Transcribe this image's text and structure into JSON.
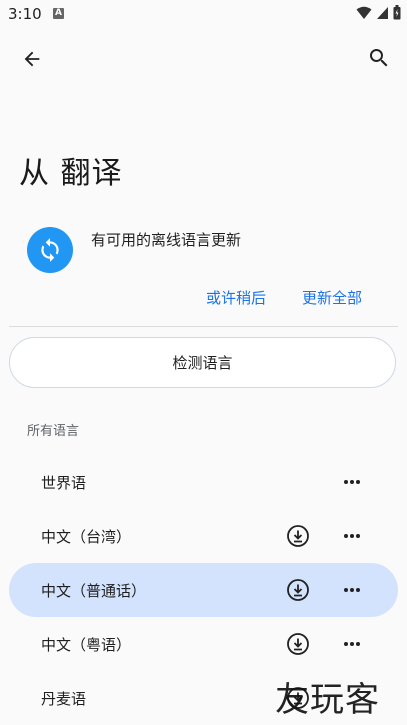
{
  "status_bar": {
    "time": "3:10",
    "notification_letter": "A"
  },
  "top_bar": {
    "back_icon": "arrow-back-icon",
    "search_icon": "search-icon"
  },
  "page_title": "从 翻译",
  "update_banner": {
    "icon": "sync-icon",
    "accent_color": "#2196f3",
    "message": "有可用的离线语言更新",
    "later_label": "或许稍后",
    "update_all_label": "更新全部"
  },
  "detect_button_label": "检测语言",
  "section_label": "所有语言",
  "languages": [
    {
      "name": "世界语",
      "downloadable": false,
      "selected": false
    },
    {
      "name": "中文（台湾）",
      "downloadable": true,
      "selected": false
    },
    {
      "name": "中文（普通话）",
      "downloadable": true,
      "selected": true
    },
    {
      "name": "中文（粤语）",
      "downloadable": true,
      "selected": false
    },
    {
      "name": "丹麦语",
      "downloadable": true,
      "selected": false
    }
  ],
  "watermark": "友玩客"
}
